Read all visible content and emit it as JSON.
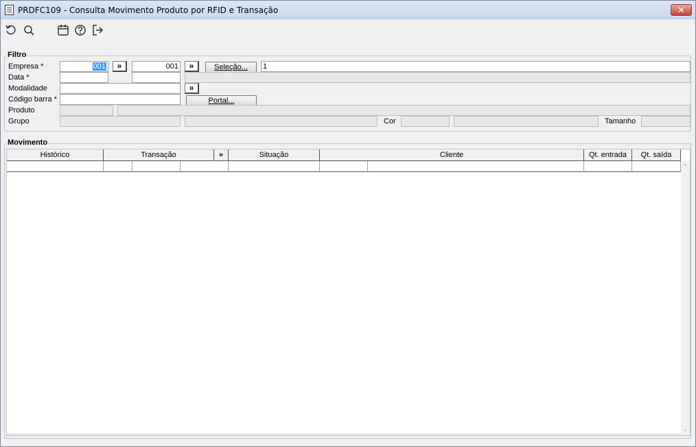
{
  "window": {
    "title": "PRDFC109 - Consulta Movimento Produto por RFID e Transação",
    "close_label": "✕"
  },
  "toolbar": {
    "icons": [
      "undo-icon",
      "search-icon",
      "calendar-icon",
      "help-icon",
      "exit-icon"
    ]
  },
  "filtro": {
    "legend": "Filtro",
    "empresa_label": "Empresa *",
    "empresa_value": "001",
    "empresa_to_value": "001",
    "data_label": "Data *",
    "modalidade_label": "Modalidade",
    "codigo_barra_label": "Código barra *",
    "produto_label": "Produto",
    "grupo_label": "Grupo",
    "cor_label": "Cor",
    "tamanho_label": "Tamanho",
    "selecao_button": "Seleção...",
    "selecao_value": "1",
    "portal_button": "Portal...",
    "double_arrow": "»"
  },
  "movimento": {
    "legend": "Movimento",
    "columns": [
      "Histórico",
      "Transação",
      "»",
      "Situação",
      "Cliente",
      "Qt. entrada",
      "Qt. saída"
    ]
  }
}
